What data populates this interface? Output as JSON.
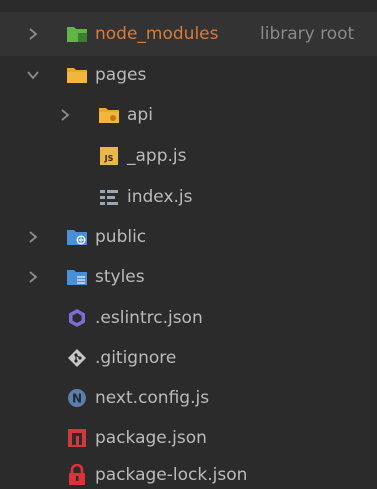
{
  "colors": {
    "background": "#2b2b2b",
    "header_row": "#333333",
    "text": "#bbbbbb",
    "excluded_text": "#d77c3c",
    "secondary_text": "#8a8a8a"
  },
  "tree": {
    "node_modules": {
      "label": "node_modules",
      "suffix": "library root",
      "icon": "green-folder-icon"
    },
    "pages": {
      "label": "pages",
      "icon": "yellow-folder-icon"
    },
    "api": {
      "label": "api",
      "icon": "yellow-folder-icon"
    },
    "app_js": {
      "label": "_app.js",
      "badge": "JS",
      "icon": "js-file-icon"
    },
    "index_js": {
      "label": "index.js",
      "icon": "text-lines-icon"
    },
    "public": {
      "label": "public",
      "icon": "blue-folder-web-icon"
    },
    "styles": {
      "label": "styles",
      "icon": "blue-folder-icon"
    },
    "eslintrc": {
      "label": ".eslintrc.json",
      "icon": "eslint-icon"
    },
    "gitignore": {
      "label": ".gitignore",
      "icon": "git-icon"
    },
    "next_config": {
      "label": "next.config.js",
      "badge": "N",
      "icon": "next-icon"
    },
    "package_json": {
      "label": "package.json",
      "icon": "npm-icon"
    },
    "package_lock": {
      "label": "package-lock.json",
      "icon": "lock-icon"
    }
  }
}
